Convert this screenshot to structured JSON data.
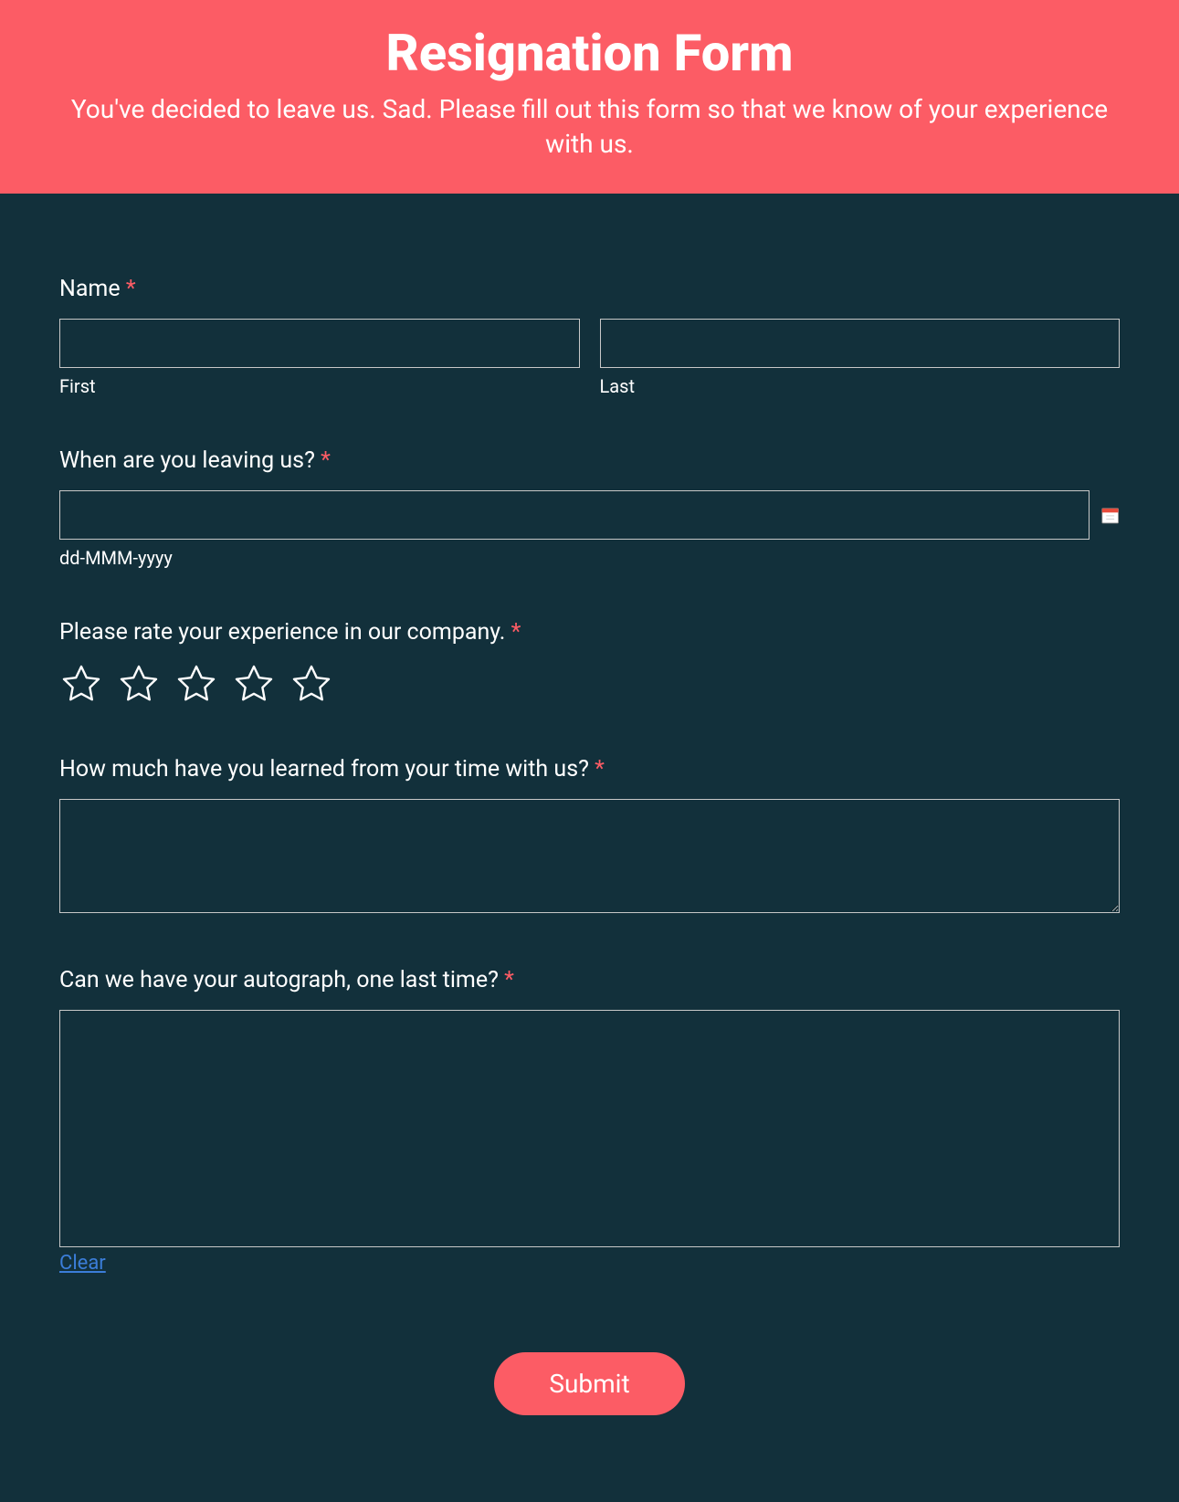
{
  "header": {
    "title": "Resignation Form",
    "subtitle": "You've decided to leave us. Sad. Please fill out this form so that we know of your experience with us."
  },
  "name": {
    "label": "Name",
    "first_sub": "First",
    "last_sub": "Last"
  },
  "leaving": {
    "label": "When are you leaving us?",
    "format": "dd-MMM-yyyy"
  },
  "rating": {
    "label": "Please rate your experience in our company."
  },
  "learned": {
    "label": "How much have you learned from your time with us?"
  },
  "autograph": {
    "label": "Can we have your autograph, one last time?",
    "clear": "Clear"
  },
  "submit": {
    "label": "Submit"
  },
  "required_marker": "*"
}
